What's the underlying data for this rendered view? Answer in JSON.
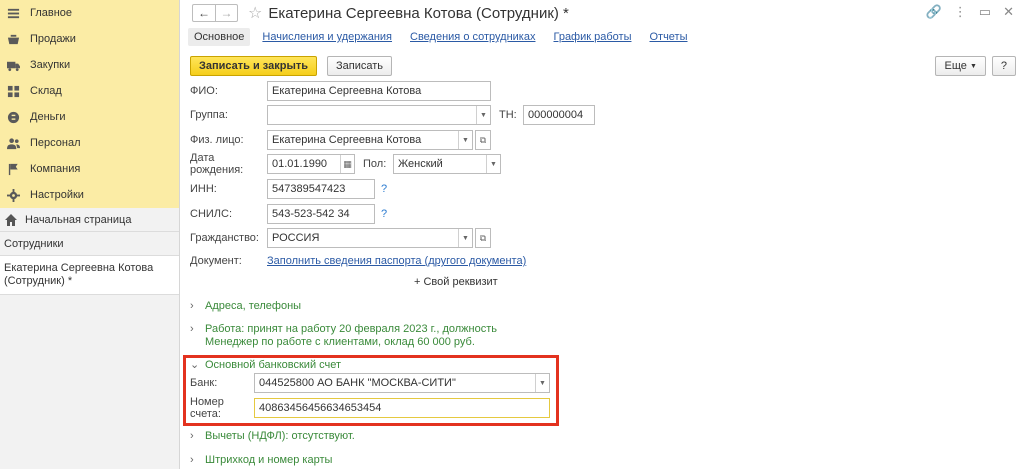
{
  "sidebar": {
    "sections": [
      {
        "label": "Главное",
        "icon": "menu-icon"
      },
      {
        "label": "Продажи",
        "icon": "basket-icon"
      },
      {
        "label": "Закупки",
        "icon": "truck-icon"
      },
      {
        "label": "Склад",
        "icon": "grid-icon"
      },
      {
        "label": "Деньги",
        "icon": "money-icon"
      },
      {
        "label": "Персонал",
        "icon": "people-icon"
      },
      {
        "label": "Компания",
        "icon": "flag-icon"
      },
      {
        "label": "Настройки",
        "icon": "gear-icon"
      }
    ],
    "home": "Начальная страница",
    "employees": "Сотрудники",
    "open_doc": "Екатерина Сергеевна Котова (Сотрудник) *"
  },
  "header": {
    "title": "Екатерина Сергеевна Котова (Сотрудник) *"
  },
  "tabs": [
    "Основное",
    "Начисления и удержания",
    "Сведения о сотрудниках",
    "График работы",
    "Отчеты"
  ],
  "toolbar": {
    "save_close": "Записать и закрыть",
    "save": "Записать",
    "more": "Еще",
    "help": "?"
  },
  "form": {
    "fio_label": "ФИО:",
    "fio_value": "Екатерина Сергеевна Котова",
    "group_label": "Группа:",
    "group_value": "",
    "tn_label": "ТН:",
    "tn_value": "000000004",
    "person_label": "Физ. лицо:",
    "person_value": "Екатерина Сергеевна Котова",
    "birth_label": "Дата рождения:",
    "birth_value": "01.01.1990",
    "sex_label": "Пол:",
    "sex_value": "Женский",
    "inn_label": "ИНН:",
    "inn_value": "547389547423",
    "snils_label": "СНИЛС:",
    "snils_value": "543-523-542 34",
    "citizenship_label": "Гражданство:",
    "citizenship_value": "РОССИЯ",
    "document_label": "Документ:",
    "document_link": "Заполнить сведения паспорта (другого документа)",
    "own_attr": "+ Свой реквизит",
    "help_mark": "?"
  },
  "groups": {
    "addresses": "Адреса, телефоны",
    "work_line1": "Работа: принят на работу 20 февраля 2023 г., должность",
    "work_line2": "Менеджер по работе с клиентами, оклад 60 000 руб.",
    "bank_account": "Основной банковский счет",
    "bank_label": "Банк:",
    "bank_value": "044525800 АО БАНК \"МОСКВА-СИТИ\"",
    "account_label": "Номер счета:",
    "account_value": "40863456456634653454",
    "deductions": "Вычеты (НДФЛ): отсутствуют.",
    "barcode": "Штрихкод и номер карты"
  },
  "colors": {
    "sections_bg": "#fbeca5",
    "primary_btn": "#f5ce1b",
    "link": "#2b5aa5",
    "group": "#3a8a3a",
    "highlight": "#e3321f"
  }
}
